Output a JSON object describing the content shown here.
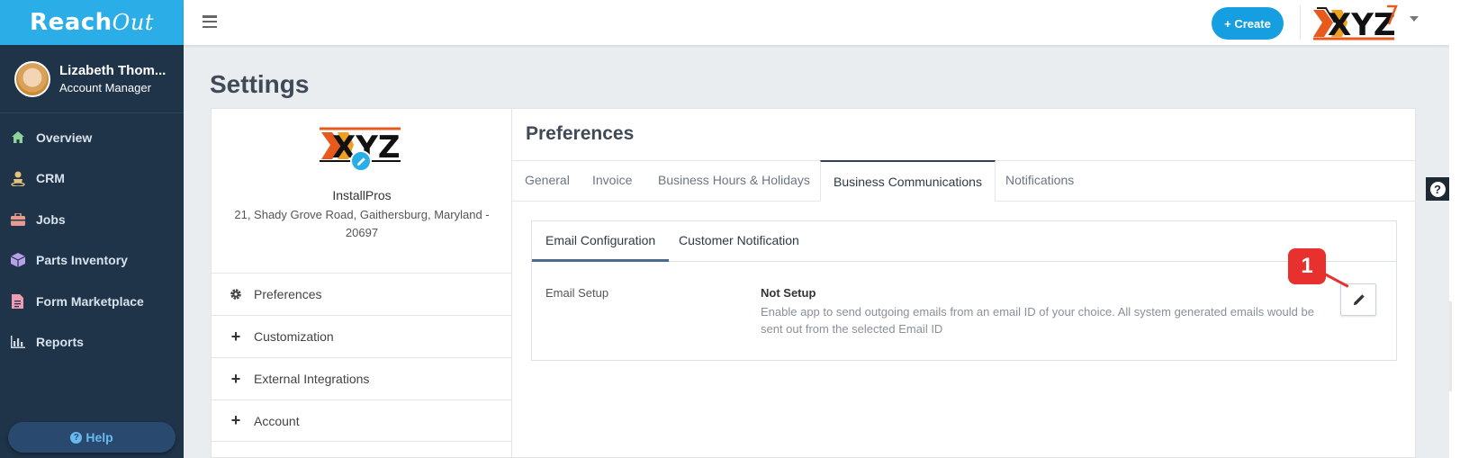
{
  "brand": {
    "reach": "Reach",
    "out": "Out"
  },
  "user": {
    "name": "Lizabeth Thom...",
    "role": "Account Manager"
  },
  "nav": [
    {
      "label": "Overview",
      "icon": "home-icon"
    },
    {
      "label": "CRM",
      "icon": "person-icon"
    },
    {
      "label": "Jobs",
      "icon": "briefcase-icon"
    },
    {
      "label": "Parts Inventory",
      "icon": "box-icon"
    },
    {
      "label": "Form Marketplace",
      "icon": "document-icon"
    },
    {
      "label": "Reports",
      "icon": "bar-chart-icon"
    }
  ],
  "help_label": "Help",
  "topbar": {
    "create_label": "+ Create",
    "logo_text": "XYZ"
  },
  "page_title": "Settings",
  "company": {
    "logo_text": "XYZ",
    "name": "InstallPros",
    "address": "21, Shady Grove Road, Gaithersburg, Maryland - 20697"
  },
  "menu": [
    {
      "label": "Preferences",
      "icon": "gear-icon"
    },
    {
      "label": "Customization",
      "icon": "plus-icon"
    },
    {
      "label": "External Integrations",
      "icon": "plus-icon"
    },
    {
      "label": "Account",
      "icon": "plus-icon"
    }
  ],
  "preferences": {
    "title": "Preferences",
    "tabs": [
      "General",
      "Invoice",
      "Business Hours & Holidays",
      "Business Communications",
      "Notifications"
    ],
    "active_tab": "Business Communications",
    "subtabs": [
      "Email Configuration",
      "Customer Notification"
    ],
    "active_subtab": "Email Configuration",
    "email": {
      "label": "Email Setup",
      "status": "Not Setup",
      "description": "Enable app to send outgoing emails from an email ID of your choice. All system generated emails would be sent out from the selected Email ID"
    }
  },
  "annotation": {
    "number": "1"
  },
  "colors": {
    "brand": "#2baee7",
    "sidebar": "#1f3349",
    "create": "#159fe0",
    "callout": "#e8302f"
  }
}
